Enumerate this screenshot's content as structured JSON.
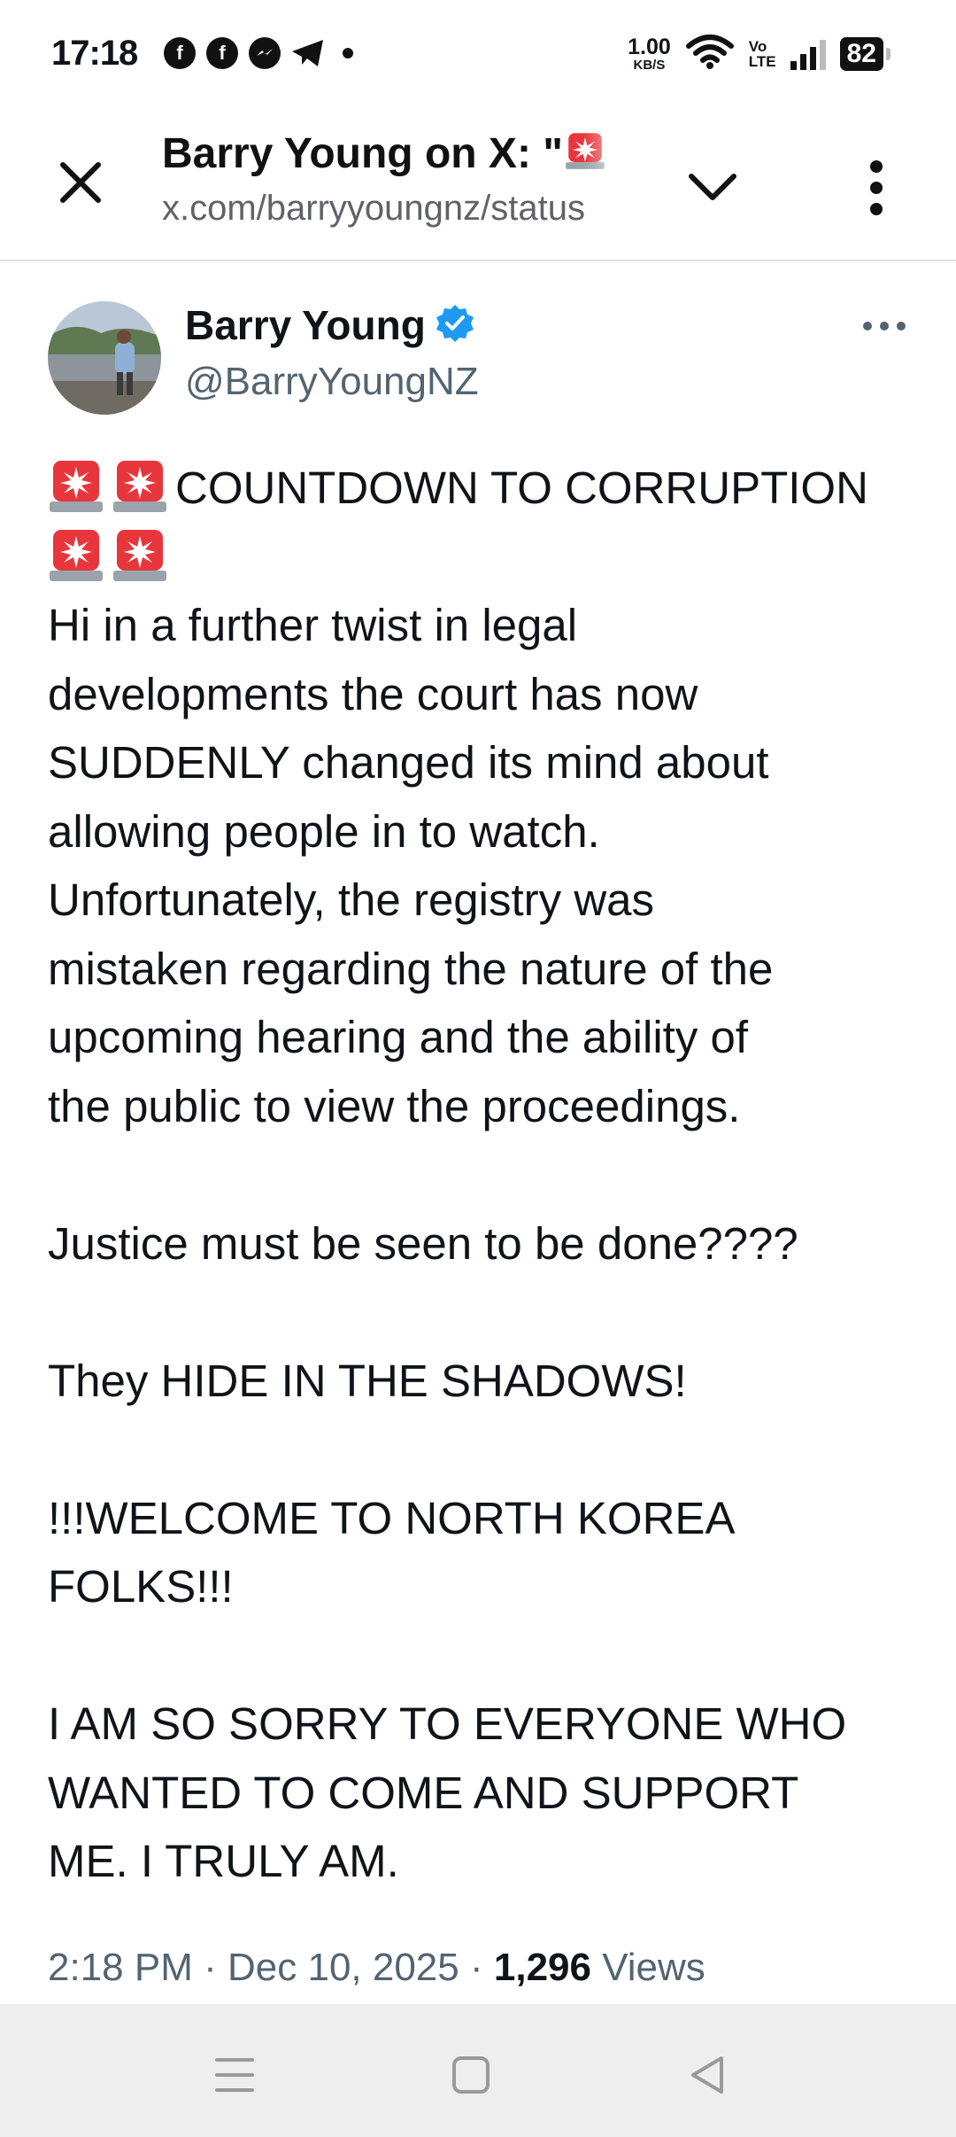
{
  "status_bar": {
    "time": "17:18",
    "app_icons": [
      "facebook-icon",
      "facebook-icon",
      "messenger-icon",
      "telegram-icon"
    ],
    "net_speed_value": "1.00",
    "net_speed_unit": "KB/S",
    "volte_top": "Vo",
    "volte_bottom": "LTE",
    "battery": "82"
  },
  "browser": {
    "title": "Barry Young on X: \"",
    "url": "x.com/barryyoungnz/status"
  },
  "tweet": {
    "display_name": "Barry Young",
    "handle": "@BarryYoungNZ",
    "heading": "COUNTDOWN TO CORRUPTION",
    "lines": [
      "Hi in a further twist in legal",
      "developments the court has now",
      "SUDDENLY changed its mind about",
      "allowing people in to watch.",
      "Unfortunately,  the registry was",
      "mistaken regarding the nature of the",
      "upcoming hearing  and the ability of",
      "the public to view the proceedings."
    ],
    "line_justice": "Justice must be seen to be done????",
    "line_shadows": "They HIDE IN THE SHADOWS!",
    "line_korea_1": "!!!WELCOME TO NORTH KOREA",
    "line_korea_2": "FOLKS!!!",
    "line_sorry_1": "I AM SO SORRY TO EVERYONE WHO",
    "line_sorry_2": "WANTED TO COME AND SUPPORT",
    "line_sorry_3": "ME. I TRULY AM.",
    "time": "2:18 PM",
    "date": "Dec 10, 2025",
    "views_count": "1,296",
    "views_label": "Views"
  },
  "colors": {
    "verified": "#1d9bf0",
    "secondary_text": "#536471",
    "siren_red": "#e8363c"
  }
}
